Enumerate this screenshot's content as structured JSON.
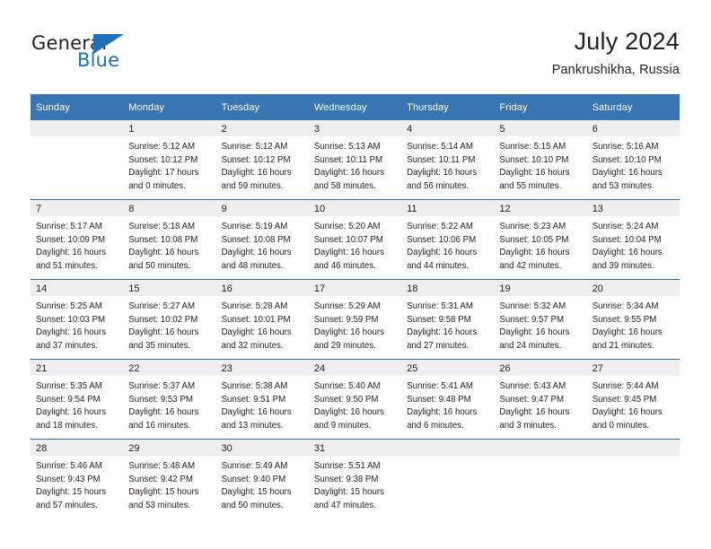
{
  "brand": {
    "name_top": "General",
    "name_bottom": "Blue",
    "accent_color": "#1d70b8"
  },
  "header": {
    "title": "July 2024",
    "subtitle": "Pankrushikha, Russia"
  },
  "theme": {
    "header_row_color": "#3875b2",
    "date_band_color": "#efefef",
    "week_divider_color": "#2f6ba6",
    "text_color": "#231f20"
  },
  "calendar": {
    "weekday_headers": [
      "Sunday",
      "Monday",
      "Tuesday",
      "Wednesday",
      "Thursday",
      "Friday",
      "Saturday"
    ],
    "weeks": [
      [
        {
          "day": "",
          "sunrise": "",
          "sunset": "",
          "daylight_line1": "",
          "daylight_line2": ""
        },
        {
          "day": "1",
          "sunrise": "Sunrise: 5:12 AM",
          "sunset": "Sunset: 10:12 PM",
          "daylight_line1": "Daylight: 17 hours",
          "daylight_line2": "and 0 minutes."
        },
        {
          "day": "2",
          "sunrise": "Sunrise: 5:12 AM",
          "sunset": "Sunset: 10:12 PM",
          "daylight_line1": "Daylight: 16 hours",
          "daylight_line2": "and 59 minutes."
        },
        {
          "day": "3",
          "sunrise": "Sunrise: 5:13 AM",
          "sunset": "Sunset: 10:11 PM",
          "daylight_line1": "Daylight: 16 hours",
          "daylight_line2": "and 58 minutes."
        },
        {
          "day": "4",
          "sunrise": "Sunrise: 5:14 AM",
          "sunset": "Sunset: 10:11 PM",
          "daylight_line1": "Daylight: 16 hours",
          "daylight_line2": "and 56 minutes."
        },
        {
          "day": "5",
          "sunrise": "Sunrise: 5:15 AM",
          "sunset": "Sunset: 10:10 PM",
          "daylight_line1": "Daylight: 16 hours",
          "daylight_line2": "and 55 minutes."
        },
        {
          "day": "6",
          "sunrise": "Sunrise: 5:16 AM",
          "sunset": "Sunset: 10:10 PM",
          "daylight_line1": "Daylight: 16 hours",
          "daylight_line2": "and 53 minutes."
        }
      ],
      [
        {
          "day": "7",
          "sunrise": "Sunrise: 5:17 AM",
          "sunset": "Sunset: 10:09 PM",
          "daylight_line1": "Daylight: 16 hours",
          "daylight_line2": "and 51 minutes."
        },
        {
          "day": "8",
          "sunrise": "Sunrise: 5:18 AM",
          "sunset": "Sunset: 10:08 PM",
          "daylight_line1": "Daylight: 16 hours",
          "daylight_line2": "and 50 minutes."
        },
        {
          "day": "9",
          "sunrise": "Sunrise: 5:19 AM",
          "sunset": "Sunset: 10:08 PM",
          "daylight_line1": "Daylight: 16 hours",
          "daylight_line2": "and 48 minutes."
        },
        {
          "day": "10",
          "sunrise": "Sunrise: 5:20 AM",
          "sunset": "Sunset: 10:07 PM",
          "daylight_line1": "Daylight: 16 hours",
          "daylight_line2": "and 46 minutes."
        },
        {
          "day": "11",
          "sunrise": "Sunrise: 5:22 AM",
          "sunset": "Sunset: 10:06 PM",
          "daylight_line1": "Daylight: 16 hours",
          "daylight_line2": "and 44 minutes."
        },
        {
          "day": "12",
          "sunrise": "Sunrise: 5:23 AM",
          "sunset": "Sunset: 10:05 PM",
          "daylight_line1": "Daylight: 16 hours",
          "daylight_line2": "and 42 minutes."
        },
        {
          "day": "13",
          "sunrise": "Sunrise: 5:24 AM",
          "sunset": "Sunset: 10:04 PM",
          "daylight_line1": "Daylight: 16 hours",
          "daylight_line2": "and 39 minutes."
        }
      ],
      [
        {
          "day": "14",
          "sunrise": "Sunrise: 5:25 AM",
          "sunset": "Sunset: 10:03 PM",
          "daylight_line1": "Daylight: 16 hours",
          "daylight_line2": "and 37 minutes."
        },
        {
          "day": "15",
          "sunrise": "Sunrise: 5:27 AM",
          "sunset": "Sunset: 10:02 PM",
          "daylight_line1": "Daylight: 16 hours",
          "daylight_line2": "and 35 minutes."
        },
        {
          "day": "16",
          "sunrise": "Sunrise: 5:28 AM",
          "sunset": "Sunset: 10:01 PM",
          "daylight_line1": "Daylight: 16 hours",
          "daylight_line2": "and 32 minutes."
        },
        {
          "day": "17",
          "sunrise": "Sunrise: 5:29 AM",
          "sunset": "Sunset: 9:59 PM",
          "daylight_line1": "Daylight: 16 hours",
          "daylight_line2": "and 29 minutes."
        },
        {
          "day": "18",
          "sunrise": "Sunrise: 5:31 AM",
          "sunset": "Sunset: 9:58 PM",
          "daylight_line1": "Daylight: 16 hours",
          "daylight_line2": "and 27 minutes."
        },
        {
          "day": "19",
          "sunrise": "Sunrise: 5:32 AM",
          "sunset": "Sunset: 9:57 PM",
          "daylight_line1": "Daylight: 16 hours",
          "daylight_line2": "and 24 minutes."
        },
        {
          "day": "20",
          "sunrise": "Sunrise: 5:34 AM",
          "sunset": "Sunset: 9:55 PM",
          "daylight_line1": "Daylight: 16 hours",
          "daylight_line2": "and 21 minutes."
        }
      ],
      [
        {
          "day": "21",
          "sunrise": "Sunrise: 5:35 AM",
          "sunset": "Sunset: 9:54 PM",
          "daylight_line1": "Daylight: 16 hours",
          "daylight_line2": "and 18 minutes."
        },
        {
          "day": "22",
          "sunrise": "Sunrise: 5:37 AM",
          "sunset": "Sunset: 9:53 PM",
          "daylight_line1": "Daylight: 16 hours",
          "daylight_line2": "and 16 minutes."
        },
        {
          "day": "23",
          "sunrise": "Sunrise: 5:38 AM",
          "sunset": "Sunset: 9:51 PM",
          "daylight_line1": "Daylight: 16 hours",
          "daylight_line2": "and 13 minutes."
        },
        {
          "day": "24",
          "sunrise": "Sunrise: 5:40 AM",
          "sunset": "Sunset: 9:50 PM",
          "daylight_line1": "Daylight: 16 hours",
          "daylight_line2": "and 9 minutes."
        },
        {
          "day": "25",
          "sunrise": "Sunrise: 5:41 AM",
          "sunset": "Sunset: 9:48 PM",
          "daylight_line1": "Daylight: 16 hours",
          "daylight_line2": "and 6 minutes."
        },
        {
          "day": "26",
          "sunrise": "Sunrise: 5:43 AM",
          "sunset": "Sunset: 9:47 PM",
          "daylight_line1": "Daylight: 16 hours",
          "daylight_line2": "and 3 minutes."
        },
        {
          "day": "27",
          "sunrise": "Sunrise: 5:44 AM",
          "sunset": "Sunset: 9:45 PM",
          "daylight_line1": "Daylight: 16 hours",
          "daylight_line2": "and 0 minutes."
        }
      ],
      [
        {
          "day": "28",
          "sunrise": "Sunrise: 5:46 AM",
          "sunset": "Sunset: 9:43 PM",
          "daylight_line1": "Daylight: 15 hours",
          "daylight_line2": "and 57 minutes."
        },
        {
          "day": "29",
          "sunrise": "Sunrise: 5:48 AM",
          "sunset": "Sunset: 9:42 PM",
          "daylight_line1": "Daylight: 15 hours",
          "daylight_line2": "and 53 minutes."
        },
        {
          "day": "30",
          "sunrise": "Sunrise: 5:49 AM",
          "sunset": "Sunset: 9:40 PM",
          "daylight_line1": "Daylight: 15 hours",
          "daylight_line2": "and 50 minutes."
        },
        {
          "day": "31",
          "sunrise": "Sunrise: 5:51 AM",
          "sunset": "Sunset: 9:38 PM",
          "daylight_line1": "Daylight: 15 hours",
          "daylight_line2": "and 47 minutes."
        },
        {
          "day": "",
          "sunrise": "",
          "sunset": "",
          "daylight_line1": "",
          "daylight_line2": ""
        },
        {
          "day": "",
          "sunrise": "",
          "sunset": "",
          "daylight_line1": "",
          "daylight_line2": ""
        },
        {
          "day": "",
          "sunrise": "",
          "sunset": "",
          "daylight_line1": "",
          "daylight_line2": ""
        }
      ]
    ]
  }
}
